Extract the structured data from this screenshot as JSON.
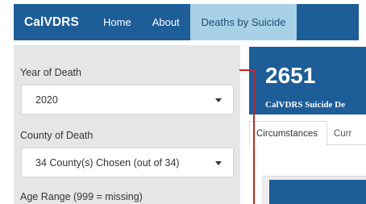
{
  "navbar": {
    "brand": "CalVDRS",
    "links": [
      {
        "label": "Home"
      },
      {
        "label": "About"
      },
      {
        "label": "Deaths by Suicide"
      }
    ]
  },
  "sidebar": {
    "year_label": "Year of Death",
    "year_value": "2020",
    "county_label": "County of Death",
    "county_value": "34 County(s) Chosen (out of 34)",
    "age_label": "Age Range (999 = missing)"
  },
  "value_box": {
    "number": "2651",
    "subtitle": "CalVDRS Suicide De"
  },
  "tabs": [
    {
      "label": "Circumstances"
    },
    {
      "label": "Curr"
    }
  ],
  "colors": {
    "navbar": "#1d5d98",
    "active_tab": "#a8d0e6",
    "sidebar": "#e4e6e8",
    "annotation": "#cc2222"
  }
}
